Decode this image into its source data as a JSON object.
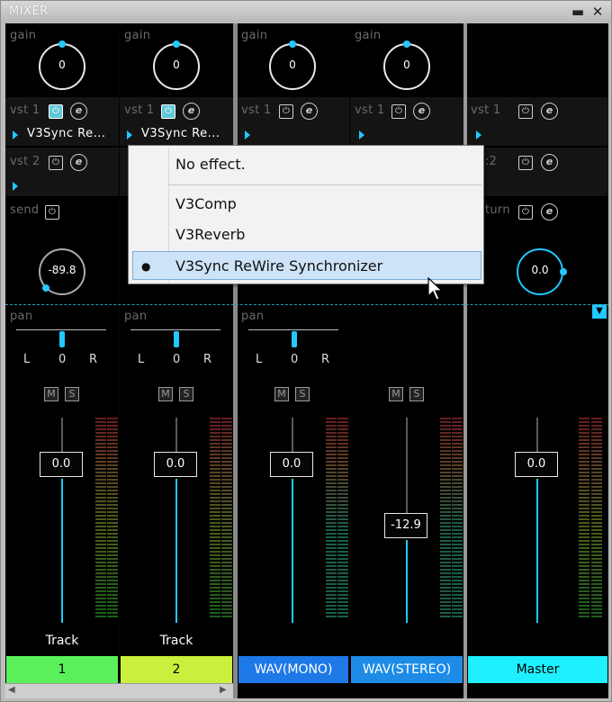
{
  "window": {
    "title": "MIXER",
    "min_glyph": "▬",
    "close_glyph": "✕"
  },
  "labels": {
    "gain": "gain",
    "vst1": "vst 1",
    "vst2": "vst 2",
    "send": "send",
    "return": "turn",
    "pan": "pan",
    "L": "L",
    "R": "R",
    "M": "M",
    "S": "S",
    "power": "⏻",
    "effect": "e",
    "vst2_partial": ":2",
    "pan_center": "0"
  },
  "strips": [
    {
      "gain": "0",
      "vst1_effect": "V3Sync Re...",
      "send": "-89.8",
      "fader": "0.0",
      "name": "Track",
      "label": "1",
      "color": "#5af05a",
      "text_color": "#000"
    },
    {
      "gain": "0",
      "vst1_effect": "V3Sync Re...",
      "fader": "0.0",
      "name": "Track",
      "label": "2",
      "color": "#c8f03c",
      "text_color": "#000"
    },
    {
      "gain": "0",
      "fader": "0.0",
      "name": "",
      "label": "WAV(MONO)",
      "color": "#1e78e6",
      "text_color": "#fff"
    },
    {
      "gain": "0",
      "fader": "-12.9",
      "name": "",
      "label": "WAV(STEREO)",
      "color": "#1e8ce6",
      "text_color": "#fff"
    },
    {
      "return": "0.0",
      "fader": "0.0",
      "name": "",
      "label": "Master",
      "color": "#1ef0ff",
      "text_color": "#000"
    }
  ],
  "menu": {
    "items": [
      {
        "label": "No effect."
      },
      {
        "label": "V3Comp"
      },
      {
        "label": "V3Reverb"
      },
      {
        "label": "V3Sync ReWire Synchronizer",
        "selected": true,
        "bullet": "●"
      }
    ]
  },
  "colors": {
    "accent": "#22c8ff",
    "meter_red": "#bb3333",
    "meter_green": "#33aa33"
  }
}
